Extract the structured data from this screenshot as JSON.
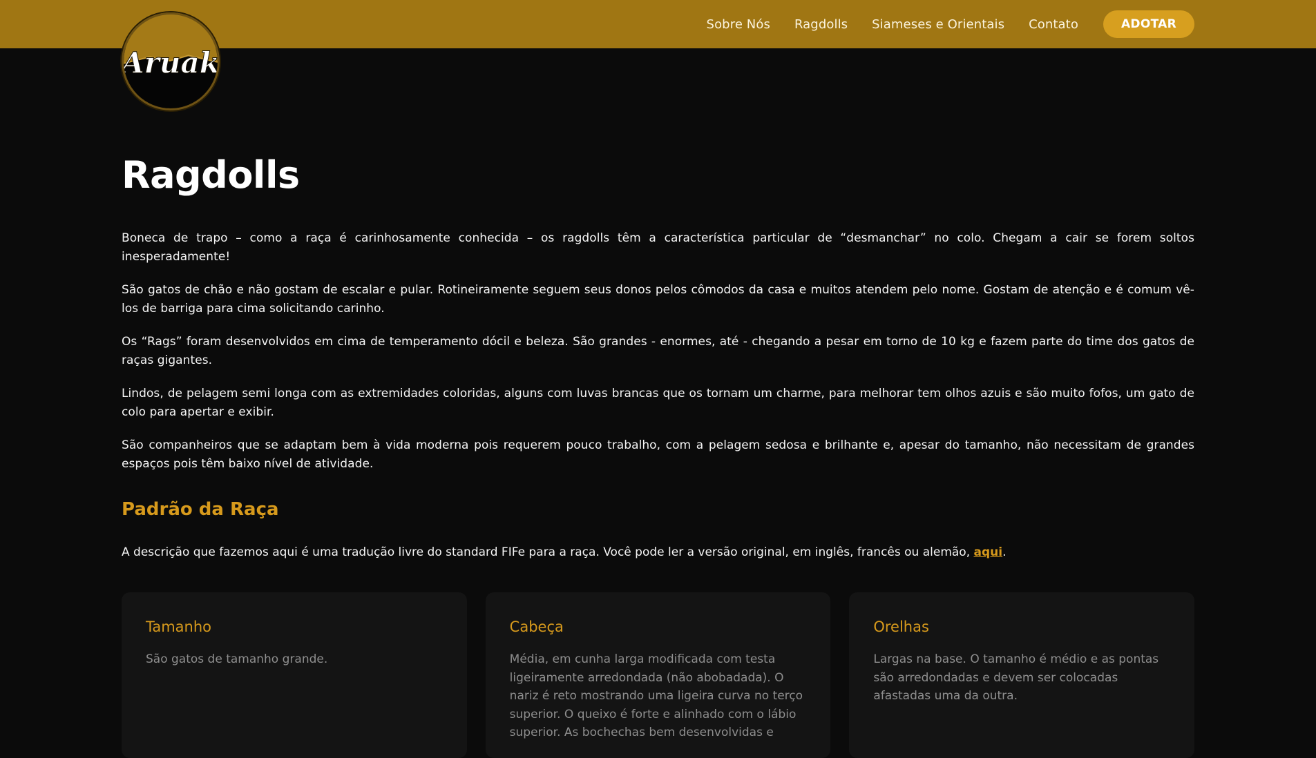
{
  "colors": {
    "header_bg": "#a07613",
    "accent": "#d79a1c",
    "cta_bg": "#d79f1f",
    "page_bg": "#0b0b0b",
    "card_bg": "#141414"
  },
  "logo": {
    "text": "Aruak"
  },
  "nav": {
    "items": [
      {
        "label": "Sobre Nós"
      },
      {
        "label": "Ragdolls"
      },
      {
        "label": "Siameses e Orientais"
      },
      {
        "label": "Contato"
      }
    ],
    "cta_label": "ADOTAR"
  },
  "main": {
    "title": "Ragdolls",
    "paragraphs": [
      "Boneca de trapo – como a raça é carinhosamente conhecida – os ragdolls têm a característica particular de “desmanchar” no colo. Chegam a cair se forem soltos inesperadamente!",
      "São gatos de chão e não gostam de escalar e pular. Rotineiramente seguem seus donos pelos cômodos da casa e muitos atendem pelo nome. Gostam de atenção e é comum vê-los de barriga para cima solicitando carinho.",
      "Os “Rags” foram desenvolvidos em cima de temperamento dócil e beleza. São grandes - enormes, até - chegando a pesar em torno de 10 kg e fazem parte do time dos gatos de raças gigantes.",
      "Lindos, de pelagem semi longa com as extremidades coloridas, alguns com luvas brancas que os tornam um charme, para melhorar tem olhos azuis e são muito fofos, um gato de colo para apertar e exibir.",
      "São companheiros que se adaptam bem à vida moderna pois requerem pouco trabalho, com a pelagem sedosa e brilhante e, apesar do tamanho, não necessitam de grandes espaços pois têm baixo nível de atividade."
    ],
    "standard": {
      "heading": "Padrão da Raça",
      "intro_text": "A descrição que fazemos aqui é uma tradução livre do standard FIFe para a raça. Você pode ler a versão original, em inglês, francês ou alemão, ",
      "link_label": "aqui",
      "intro_end": "."
    },
    "cards": [
      {
        "title": "Tamanho",
        "text": "São gatos de tamanho grande."
      },
      {
        "title": "Cabeça",
        "text": "Média, em cunha larga modificada com testa ligeiramente arredondada (não abobadada). O nariz é reto mostrando uma ligeira curva no terço superior. O queixo é forte e alinhado com o lábio superior. As bochechas bem desenvolvidas e"
      },
      {
        "title": "Orelhas",
        "text": "Largas na base. O tamanho é médio e as pontas são arredondadas e devem ser colocadas afastadas uma da outra."
      }
    ]
  }
}
